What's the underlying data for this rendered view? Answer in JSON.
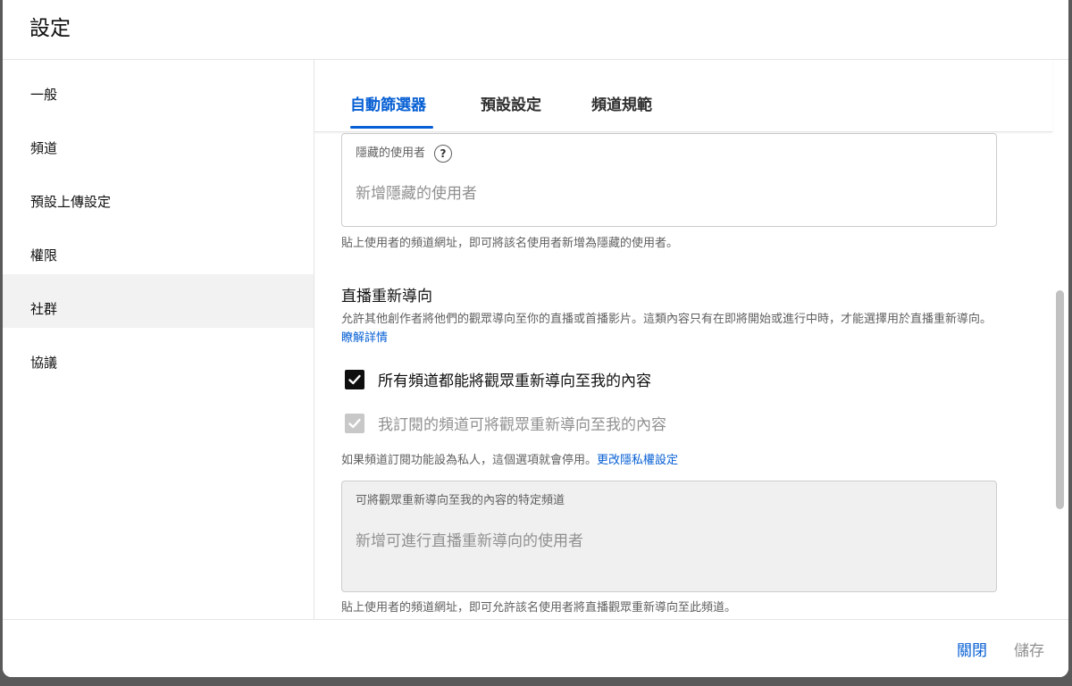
{
  "dialog": {
    "title": "設定"
  },
  "sidebar": {
    "items": [
      {
        "label": "一般"
      },
      {
        "label": "頻道"
      },
      {
        "label": "預設上傳設定"
      },
      {
        "label": "權限"
      },
      {
        "label": "社群",
        "active": true
      },
      {
        "label": "協議"
      }
    ]
  },
  "tabs": [
    {
      "label": "自動篩選器",
      "active": true
    },
    {
      "label": "預設設定"
    },
    {
      "label": "頻道規範"
    }
  ],
  "hidden_users": {
    "label": "隱藏的使用者",
    "help_icon": "?",
    "placeholder": "新增隱藏的使用者",
    "hint": "貼上使用者的頻道網址，即可將該名使用者新增為隱藏的使用者。"
  },
  "live_redirect": {
    "title": "直播重新導向",
    "description": "允許其他創作者將他們的觀眾導向至你的直播或首播影片。這類內容只有在即將開始或進行中時，才能選擇用於直播重新導向。",
    "learn_more": "瞭解詳情",
    "options": [
      {
        "label": "所有頻道都能將觀眾重新導向至我的內容",
        "checked": true,
        "disabled": false
      },
      {
        "label": "我訂閱的頻道可將觀眾重新導向至我的內容",
        "checked": true,
        "disabled": true
      }
    ],
    "privacy_note": "如果頻道訂閱功能設為私人，這個選項就會停用。",
    "privacy_link": "更改隱私權設定",
    "specific_channels": {
      "label": "可將觀眾重新導向至我的內容的特定頻道",
      "placeholder": "新增可進行直播重新導向的使用者",
      "hint": "貼上使用者的頻道網址，即可允許該名使用者將直播觀眾重新導向至此頻道。"
    }
  },
  "footer": {
    "close_label": "關閉",
    "save_label": "儲存"
  },
  "colors": {
    "accent": "#065fd4",
    "active_bg": "#f2f2f2",
    "muted": "#606060"
  }
}
